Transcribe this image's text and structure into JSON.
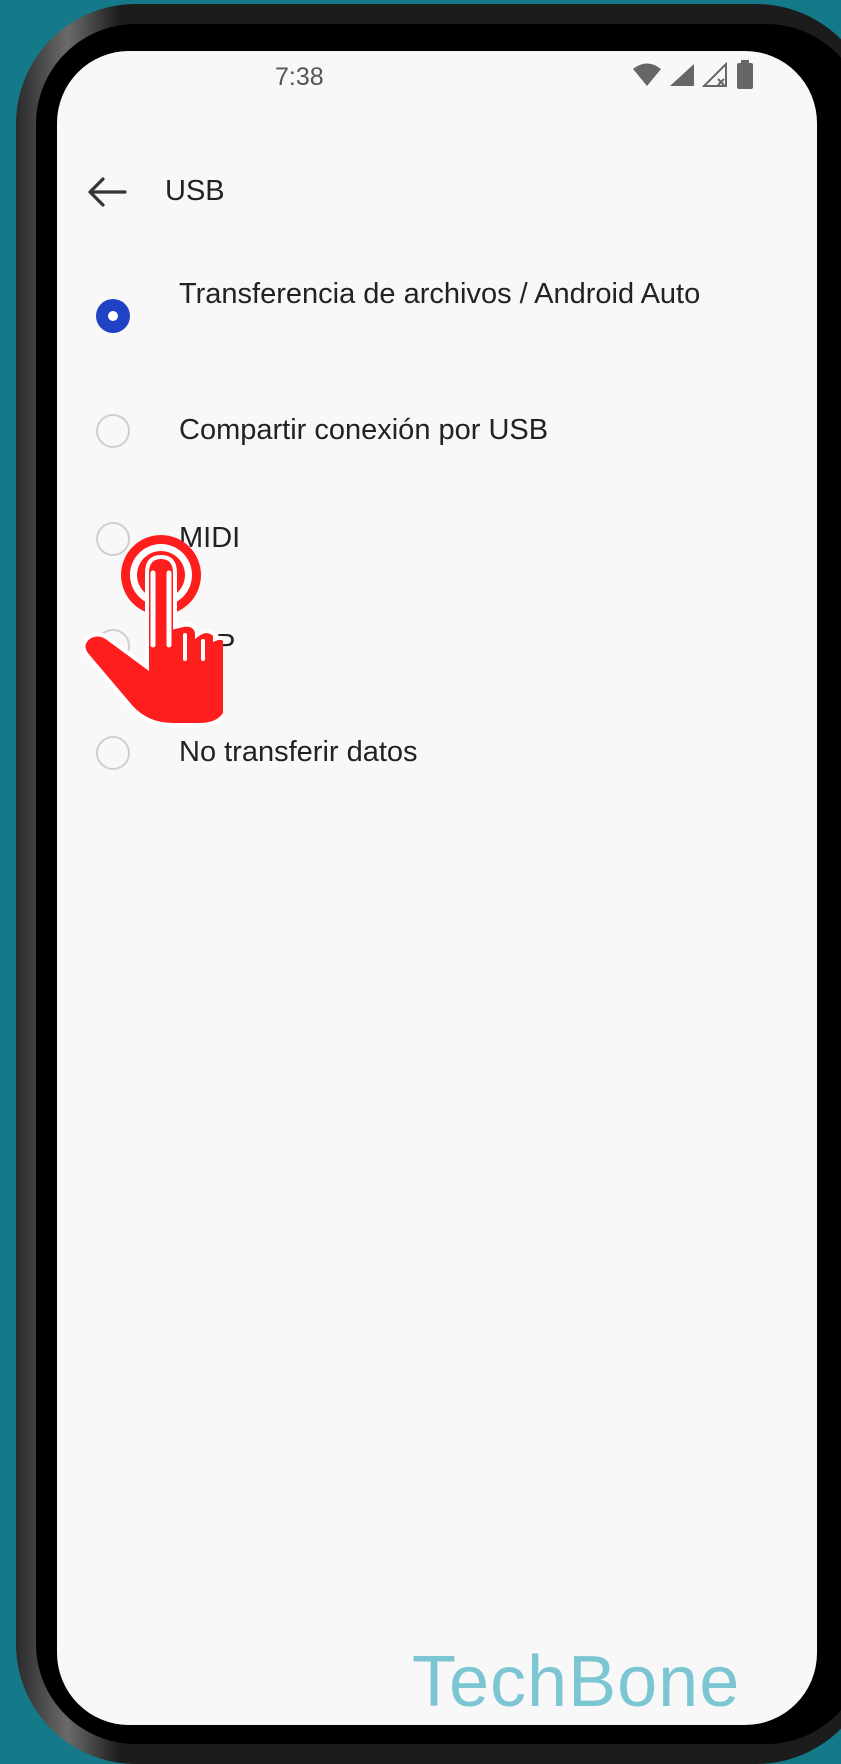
{
  "status_bar": {
    "time": "7:38",
    "icons": [
      "wifi-icon",
      "signal-icon",
      "signal-no-sim-icon",
      "battery-icon"
    ]
  },
  "header": {
    "back_icon": "arrow-left-icon",
    "title": "USB"
  },
  "options": [
    {
      "label": "Transferencia de archivos / Android Auto",
      "selected": true
    },
    {
      "label": "Compartir conexión por USB",
      "selected": false
    },
    {
      "label": "MIDI",
      "selected": false
    },
    {
      "label": "PTP",
      "selected": false
    },
    {
      "label": "No transferir datos",
      "selected": false
    }
  ],
  "overlay": {
    "tap_icon": "tap-hand-icon",
    "watermark": "TechBone"
  },
  "colors": {
    "accent": "#1f43c4",
    "background": "#147a8a",
    "tap": "#ff1e1e",
    "watermark": "#7cc6d3"
  }
}
